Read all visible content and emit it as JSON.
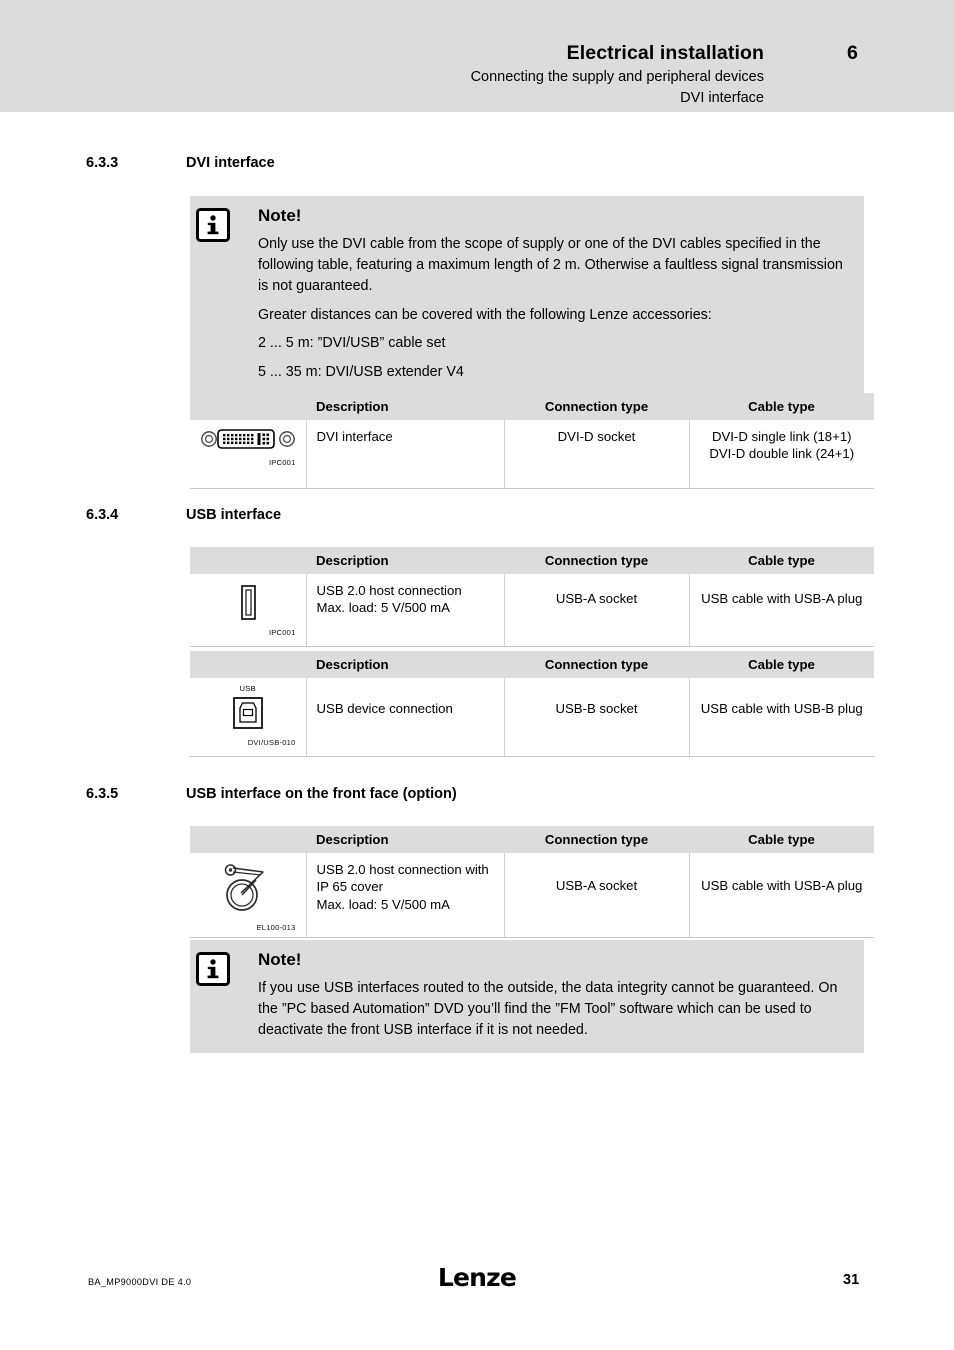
{
  "header": {
    "title": "Electrical installation",
    "chapter_number": "6",
    "subtitle_1": "Connecting the supply and peripheral devices",
    "subtitle_2": "DVI interface"
  },
  "sections": [
    {
      "number": "6.3.3",
      "title": "DVI interface"
    },
    {
      "number": "6.3.4",
      "title": "USB interface"
    },
    {
      "number": "6.3.5",
      "title": "USB interface on the front face (option)"
    }
  ],
  "note_dvi": {
    "icon": "info-icon",
    "title": "Note!",
    "paragraph_1": "Only use the DVI cable from the scope of supply or one of the DVI cables specified in the following table, featuring a maximum length of 2 m. Otherwise a faultless signal transmission is not guaranteed.",
    "paragraph_2": "Greater distances can be covered with the following Lenze accessories:",
    "line_1": "2 ... 5 m: ”DVI/USB” cable set",
    "line_2": "5 ... 35 m: DVI/USB extender V4"
  },
  "note_usb": {
    "icon": "info-icon",
    "title": "Note!",
    "paragraph_1": "If you use USB interfaces routed to the outside, the data integrity cannot be guaranteed. On the ”PC based Automation” DVD you’ll find the ”FM Tool” software which can be used to deactivate the front USB interface if it is not needed."
  },
  "table_headers": {
    "icon": "",
    "description": "Description",
    "connection_type": "Connection type",
    "cable_type": "Cable type"
  },
  "table_dvi": {
    "icon_name": "dvi-d-connector-icon",
    "icon_code": "IPC001",
    "description": "DVI interface",
    "connection_type": "DVI-D socket",
    "cable_type_line_1": "DVI-D single link (18+1)",
    "cable_type_line_2": "DVI-D double link (24+1)"
  },
  "table_usb_a": {
    "icon_name": "usb-a-socket-icon",
    "icon_code": "IPC001",
    "description_line_1": "USB 2.0 host connection",
    "description_line_2": "Max. load: 5 V/500 mA",
    "connection_type": "USB-A socket",
    "cable_type": "USB cable with USB-A plug"
  },
  "table_usb_b": {
    "icon_name": "usb-b-socket-icon",
    "icon_top_label": "USB",
    "icon_code": "DVI/USB-010",
    "description": "USB device connection",
    "connection_type": "USB-B socket",
    "cable_type": "USB cable with USB-B plug"
  },
  "table_usb_front": {
    "icon_name": "ip65-cover-icon",
    "icon_code": "EL100-013",
    "description_line_1": "USB 2.0 host connection with",
    "description_line_2": "IP 65 cover",
    "description_line_3": "Max. load: 5 V/500 mA",
    "connection_type": "USB-A socket",
    "cable_type": "USB cable with USB-A plug"
  },
  "footer": {
    "document_id": "BA_MP9000DVI  DE  4.0",
    "logo": "Lenze",
    "page_number": "31"
  },
  "colors": {
    "band_gray": "#dcdcdc",
    "rule_gray": "#c8c8c8",
    "text_black": "#000000"
  }
}
